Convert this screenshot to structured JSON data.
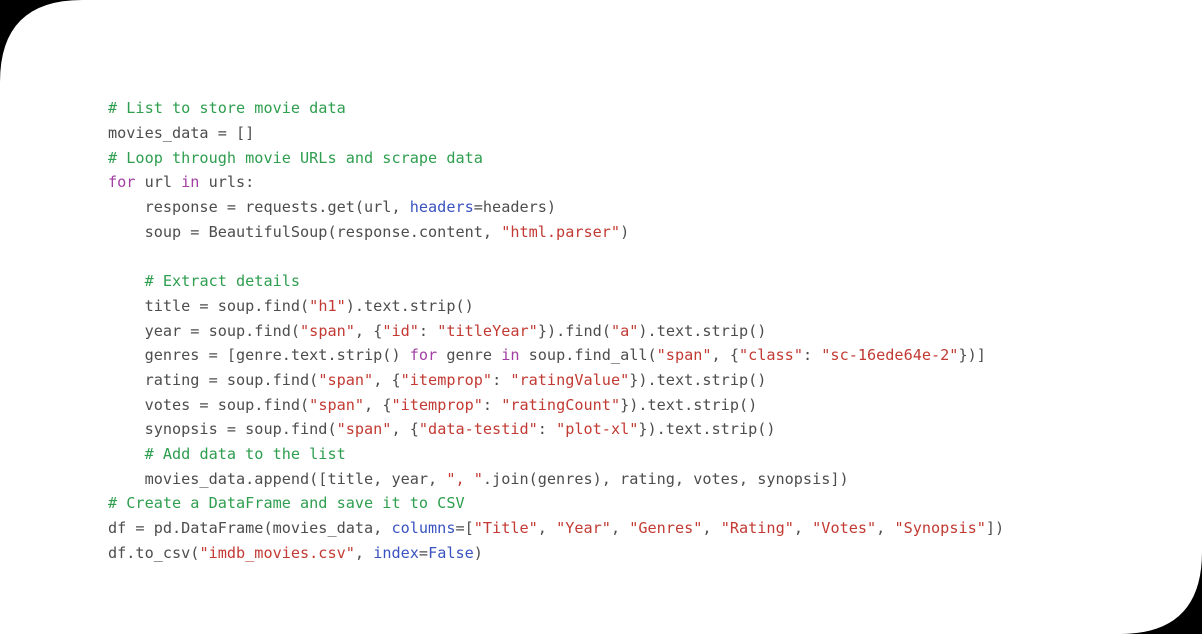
{
  "window": {
    "background_color": "#ffffff",
    "decoration_color": "#000000"
  },
  "theme": {
    "plain": "#4d4d4d",
    "comment": "#2e9e4f",
    "keyword": "#a33fa3",
    "string": "#c23a33",
    "kwarg": "#3a53c0",
    "builtin": "#3a53c0"
  },
  "code": {
    "language": "python",
    "plain_text": "# List to store movie data\nmovies_data = []\n# Loop through movie URLs and scrape data\nfor url in urls:\n    response = requests.get(url, headers=headers)\n    soup = BeautifulSoup(response.content, \"html.parser\")\n\n    # Extract details\n    title = soup.find(\"h1\").text.strip()\n    year = soup.find(\"span\", {\"id\": \"titleYear\"}).find(\"a\").text.strip()\n    genres = [genre.text.strip() for genre in soup.find_all(\"span\", {\"class\": \"sc-16ede64e-2\"})]\n    rating = soup.find(\"span\", {\"itemprop\": \"ratingValue\"}).text.strip()\n    votes = soup.find(\"span\", {\"itemprop\": \"ratingCount\"}).text.strip()\n    synopsis = soup.find(\"span\", {\"data-testid\": \"plot-xl\"}).text.strip()\n    # Add data to the list\n    movies_data.append([title, year, \", \".join(genres), rating, votes, synopsis])\n# Create a DataFrame and save it to CSV\ndf = pd.DataFrame(movies_data, columns=[\"Title\", \"Year\", \"Genres\", \"Rating\", \"Votes\", \"Synopsis\"])\ndf.to_csv(\"imdb_movies.csv\", index=False)",
    "lines": [
      [
        {
          "t": "comment",
          "s": "# List to store movie data"
        }
      ],
      [
        {
          "t": "plain",
          "s": "movies_data = []"
        }
      ],
      [
        {
          "t": "comment",
          "s": "# Loop through movie URLs and scrape data"
        }
      ],
      [
        {
          "t": "keyword",
          "s": "for"
        },
        {
          "t": "plain",
          "s": " url "
        },
        {
          "t": "keyword",
          "s": "in"
        },
        {
          "t": "plain",
          "s": " urls:"
        }
      ],
      [
        {
          "t": "plain",
          "s": "    response = requests.get(url, "
        },
        {
          "t": "kwarg",
          "s": "headers"
        },
        {
          "t": "plain",
          "s": "=headers)"
        }
      ],
      [
        {
          "t": "plain",
          "s": "    soup = BeautifulSoup(response.content, "
        },
        {
          "t": "string",
          "s": "\"html.parser\""
        },
        {
          "t": "plain",
          "s": ")"
        }
      ],
      [
        {
          "t": "plain",
          "s": ""
        }
      ],
      [
        {
          "t": "plain",
          "s": "    "
        },
        {
          "t": "comment",
          "s": "# Extract details"
        }
      ],
      [
        {
          "t": "plain",
          "s": "    title = soup.find("
        },
        {
          "t": "string",
          "s": "\"h1\""
        },
        {
          "t": "plain",
          "s": ").text.strip()"
        }
      ],
      [
        {
          "t": "plain",
          "s": "    year = soup.find("
        },
        {
          "t": "string",
          "s": "\"span\""
        },
        {
          "t": "plain",
          "s": ", {"
        },
        {
          "t": "string",
          "s": "\"id\""
        },
        {
          "t": "plain",
          "s": ": "
        },
        {
          "t": "string",
          "s": "\"titleYear\""
        },
        {
          "t": "plain",
          "s": "}).find("
        },
        {
          "t": "string",
          "s": "\"a\""
        },
        {
          "t": "plain",
          "s": ").text.strip()"
        }
      ],
      [
        {
          "t": "plain",
          "s": "    genres = [genre.text.strip() "
        },
        {
          "t": "keyword",
          "s": "for"
        },
        {
          "t": "plain",
          "s": " genre "
        },
        {
          "t": "keyword",
          "s": "in"
        },
        {
          "t": "plain",
          "s": " soup.find_all("
        },
        {
          "t": "string",
          "s": "\"span\""
        },
        {
          "t": "plain",
          "s": ", {"
        },
        {
          "t": "string",
          "s": "\"class\""
        },
        {
          "t": "plain",
          "s": ": "
        },
        {
          "t": "string",
          "s": "\"sc-16ede64e-2\""
        },
        {
          "t": "plain",
          "s": "})]"
        }
      ],
      [
        {
          "t": "plain",
          "s": "    rating = soup.find("
        },
        {
          "t": "string",
          "s": "\"span\""
        },
        {
          "t": "plain",
          "s": ", {"
        },
        {
          "t": "string",
          "s": "\"itemprop\""
        },
        {
          "t": "plain",
          "s": ": "
        },
        {
          "t": "string",
          "s": "\"ratingValue\""
        },
        {
          "t": "plain",
          "s": "}).text.strip()"
        }
      ],
      [
        {
          "t": "plain",
          "s": "    votes = soup.find("
        },
        {
          "t": "string",
          "s": "\"span\""
        },
        {
          "t": "plain",
          "s": ", {"
        },
        {
          "t": "string",
          "s": "\"itemprop\""
        },
        {
          "t": "plain",
          "s": ": "
        },
        {
          "t": "string",
          "s": "\"ratingCount\""
        },
        {
          "t": "plain",
          "s": "}).text.strip()"
        }
      ],
      [
        {
          "t": "plain",
          "s": "    synopsis = soup.find("
        },
        {
          "t": "string",
          "s": "\"span\""
        },
        {
          "t": "plain",
          "s": ", {"
        },
        {
          "t": "string",
          "s": "\"data-testid\""
        },
        {
          "t": "plain",
          "s": ": "
        },
        {
          "t": "string",
          "s": "\"plot-xl\""
        },
        {
          "t": "plain",
          "s": "}).text.strip()"
        }
      ],
      [
        {
          "t": "plain",
          "s": "    "
        },
        {
          "t": "comment",
          "s": "# Add data to the list"
        }
      ],
      [
        {
          "t": "plain",
          "s": "    movies_data.append([title, year, "
        },
        {
          "t": "string",
          "s": "\", \""
        },
        {
          "t": "plain",
          "s": ".join(genres), rating, votes, synopsis])"
        }
      ],
      [
        {
          "t": "comment",
          "s": "# Create a DataFrame and save it to CSV"
        }
      ],
      [
        {
          "t": "plain",
          "s": "df = pd.DataFrame(movies_data, "
        },
        {
          "t": "kwarg",
          "s": "columns"
        },
        {
          "t": "plain",
          "s": "=["
        },
        {
          "t": "string",
          "s": "\"Title\""
        },
        {
          "t": "plain",
          "s": ", "
        },
        {
          "t": "string",
          "s": "\"Year\""
        },
        {
          "t": "plain",
          "s": ", "
        },
        {
          "t": "string",
          "s": "\"Genres\""
        },
        {
          "t": "plain",
          "s": ", "
        },
        {
          "t": "string",
          "s": "\"Rating\""
        },
        {
          "t": "plain",
          "s": ", "
        },
        {
          "t": "string",
          "s": "\"Votes\""
        },
        {
          "t": "plain",
          "s": ", "
        },
        {
          "t": "string",
          "s": "\"Synopsis\""
        },
        {
          "t": "plain",
          "s": "])"
        }
      ],
      [
        {
          "t": "plain",
          "s": "df.to_csv("
        },
        {
          "t": "string",
          "s": "\"imdb_movies.csv\""
        },
        {
          "t": "plain",
          "s": ", "
        },
        {
          "t": "kwarg",
          "s": "index"
        },
        {
          "t": "plain",
          "s": "="
        },
        {
          "t": "builtin",
          "s": "False"
        },
        {
          "t": "plain",
          "s": ")"
        }
      ]
    ]
  }
}
